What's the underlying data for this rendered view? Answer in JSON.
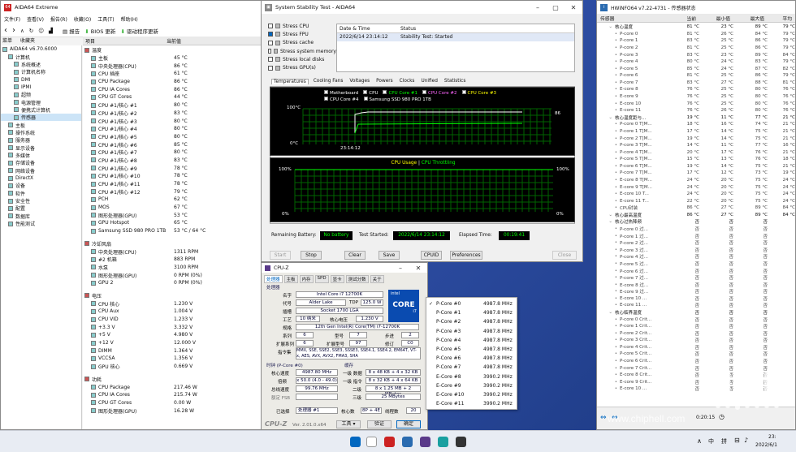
{
  "colors": {
    "aida_red": "#c8202a",
    "graph_green": "#00ff00",
    "graph_bg": "#000000",
    "graph_grid": "#006400",
    "accent": "#0067c0"
  },
  "aida": {
    "title": "AIDA64 Extreme",
    "menu": [
      "文件(F)",
      "查看(V)",
      "报告(R)",
      "收藏(O)",
      "工具(T)",
      "帮助(H)"
    ],
    "toolbar": {
      "report": "报告",
      "bios": "BIOS 更新",
      "driver": "驱动程序更新"
    },
    "tabs": [
      "菜单",
      "收藏夹"
    ],
    "tree": [
      {
        "label": "AIDA64 v6.70.6000",
        "indent": 0
      },
      {
        "label": "计算机",
        "indent": 1
      },
      {
        "label": "系统概述",
        "indent": 2
      },
      {
        "label": "计算机名称",
        "indent": 2
      },
      {
        "label": "DMI",
        "indent": 2
      },
      {
        "label": "IPMI",
        "indent": 2
      },
      {
        "label": "超频",
        "indent": 2
      },
      {
        "label": "电源管理",
        "indent": 2
      },
      {
        "label": "便携式计算机",
        "indent": 2
      },
      {
        "label": "传感器",
        "indent": 2
      },
      {
        "label": "主板",
        "indent": 1
      },
      {
        "label": "操作系统",
        "indent": 1
      },
      {
        "label": "服务器",
        "indent": 1
      },
      {
        "label": "显示设备",
        "indent": 1
      },
      {
        "label": "多媒体",
        "indent": 1
      },
      {
        "label": "存储设备",
        "indent": 1
      },
      {
        "label": "网络设备",
        "indent": 1
      },
      {
        "label": "DirectX",
        "indent": 1
      },
      {
        "label": "设备",
        "indent": 1
      },
      {
        "label": "软件",
        "indent": 1
      },
      {
        "label": "安全性",
        "indent": 1
      },
      {
        "label": "配置",
        "indent": 1
      },
      {
        "label": "数据库",
        "indent": 1
      },
      {
        "label": "性能测试",
        "indent": 1
      }
    ],
    "cols": {
      "item": "项目",
      "value": "当前值"
    },
    "sections": [
      {
        "title": "温度",
        "rows": [
          [
            "主板",
            "45 °C"
          ],
          [
            "中央处理器(CPU)",
            "86 °C"
          ],
          [
            "CPU 插座",
            "61 °C"
          ],
          [
            "CPU Package",
            "86 °C"
          ],
          [
            "CPU IA Cores",
            "86 °C"
          ],
          [
            "CPU GT Cores",
            "44 °C"
          ],
          [
            "CPU #1/核心 #1",
            "80 °C"
          ],
          [
            "CPU #1/核心 #2",
            "83 °C"
          ],
          [
            "CPU #1/核心 #3",
            "80 °C"
          ],
          [
            "CPU #1/核心 #4",
            "80 °C"
          ],
          [
            "CPU #1/核心 #5",
            "80 °C"
          ],
          [
            "CPU #1/核心 #6",
            "85 °C"
          ],
          [
            "CPU #1/核心 #7",
            "80 °C"
          ],
          [
            "CPU #1/核心 #8",
            "83 °C"
          ],
          [
            "CPU #1/核心 #9",
            "78 °C"
          ],
          [
            "CPU #1/核心 #10",
            "78 °C"
          ],
          [
            "CPU #1/核心 #11",
            "78 °C"
          ],
          [
            "CPU #1/核心 #12",
            "79 °C"
          ],
          [
            "PCH",
            "62 °C"
          ],
          [
            "MOS",
            "67 °C"
          ],
          [
            "图形处理器(GPU)",
            "53 °C"
          ],
          [
            "GPU Hotspot",
            "65 °C"
          ],
          [
            "Samsung SSD 980 PRO 1TB",
            "53 °C / 64 °C"
          ]
        ]
      },
      {
        "title": "冷却风扇",
        "rows": [
          [
            "中央处理器(CPU)",
            "1311 RPM"
          ],
          [
            "#2 机箱",
            "883 RPM"
          ],
          [
            "水泵",
            "3100 RPM"
          ],
          [
            "图形处理器(GPU)",
            "0 RPM  (0%)"
          ],
          [
            "GPU 2",
            "0 RPM  (0%)"
          ]
        ]
      },
      {
        "title": "电压",
        "rows": [
          [
            "CPU 核心",
            "1.230 V"
          ],
          [
            "CPU Aux",
            "1.004 V"
          ],
          [
            "CPU VID",
            "1.233 V"
          ],
          [
            "+3.3 V",
            "3.332 V"
          ],
          [
            "+5 V",
            "4.980 V"
          ],
          [
            "+12 V",
            "12.000 V"
          ],
          [
            "DIMM",
            "1.364 V"
          ],
          [
            "VCCSA",
            "1.356 V"
          ],
          [
            "GPU 核心",
            "0.669 V"
          ]
        ]
      },
      {
        "title": "功耗",
        "rows": [
          [
            "CPU Package",
            "217.46 W"
          ],
          [
            "CPU IA Cores",
            "215.74 W"
          ],
          [
            "CPU GT Cores",
            "0.00 W"
          ],
          [
            "图形处理器(GPU)",
            "16.28 W"
          ]
        ]
      }
    ]
  },
  "sst": {
    "title": "System Stability Test - AIDA64",
    "stress": [
      {
        "label": "Stress CPU",
        "checked": false
      },
      {
        "label": "Stress FPU",
        "checked": true
      },
      {
        "label": "Stress cache",
        "checked": false
      },
      {
        "label": "Stress system memory",
        "checked": false
      },
      {
        "label": "Stress local disks",
        "checked": false
      },
      {
        "label": "Stress GPU(s)",
        "checked": false
      }
    ],
    "log": {
      "col_dt": "Date & Time",
      "col_status": "Status",
      "dt": "2022/6/14 23:14:12",
      "status": "Stability Test: Started"
    },
    "tabs": [
      "Temperatures",
      "Cooling Fans",
      "Voltages",
      "Powers",
      "Clocks",
      "Unified",
      "Statistics"
    ],
    "legend": [
      "Motherboard",
      "CPU",
      "CPU Core #1",
      "CPU Core #2",
      "CPU Core #3",
      "CPU Core #4",
      "Samsung SSD 980 PRO 1TB"
    ],
    "graph1": {
      "ymax": "100°C",
      "ymin": "0°C",
      "time": "23:14:12",
      "val": "86"
    },
    "graph2": {
      "title_a": "CPU Usage",
      "sep": "|",
      "title_b": "CPU Throttling",
      "ymax": "100%",
      "ymin": "0%",
      "rmax": "100%",
      "rmin": "0%"
    },
    "battery_label": "Remaining Battery:",
    "battery_val": "No battery",
    "started_label": "Test Started:",
    "started_val": "2022/6/14 23:14:12",
    "elapsed_label": "Elapsed Time:",
    "elapsed_val": "00:19:41",
    "buttons": {
      "start": "Start",
      "stop": "Stop",
      "clear": "Clear",
      "save": "Save",
      "cpuid": "CPUID",
      "prefs": "Preferences",
      "close": "Close"
    }
  },
  "cpuz": {
    "title": "CPU-Z",
    "tabs": [
      "处理器",
      "主板",
      "内存",
      "SPD",
      "显卡",
      "测试分数",
      "关于"
    ],
    "group": "处理器",
    "name_l": "名字",
    "name": "Intel Core i7 12700K",
    "code_l": "代号",
    "code": "Alder Lake",
    "tdp_l": "TDP",
    "tdp": "125.0 W",
    "pkg_l": "插槽",
    "pkg": "Socket 1700 LGA",
    "tech_l": "工艺",
    "tech": "10 纳米",
    "vcore_l": "核心电压",
    "vcore": "1.230 V",
    "spec_l": "规格",
    "spec": "12th Gen Intel(R) Core(TM) i7-12700K",
    "fam_l": "系列",
    "fam": "6",
    "model_l": "型号",
    "model": "7",
    "step_l": "步进",
    "step": "2",
    "xfam_l": "扩展系列",
    "xfam": "6",
    "xmod_l": "扩展型号",
    "xmod": "97",
    "rev_l": "修订",
    "rev": "C0",
    "inst_l": "指令集",
    "inst": "MMX, SSE, SSE2, SSE3, SSSE3, SSE4.1, SSE4.2, EM64T, VT-x, AES, AVX, AVX2, FMA3, SHA",
    "clk_group": "时钟 (P-Core #0)",
    "cache_group": "缓存",
    "cs_l": "核心速度",
    "cs": "4987.80 MHz",
    "mul_l": "倍频",
    "mul": "x 50.0 (4.0 - 49.0)",
    "bus_l": "总线速度",
    "bus": "99.76 MHz",
    "fsb_l": "额定 FSB",
    "fsb": "",
    "l1d_l": "一级 数据",
    "l1d": "8 x 48 KB + 4 x 32 KB",
    "l1i_l": "一级 指令",
    "l1i": "8 x 32 KB + 4 x 64 KB",
    "l2_l": "二级",
    "l2": "8 x 1.25 MB + 2 MBytes",
    "l3_l": "三级",
    "l3": "25 MBytes",
    "sel_l": "已选择",
    "sel": "处理器 #1",
    "cores_l": "核心数",
    "cores": "8P + 4E",
    "thr_l": "线程数",
    "thr": "20",
    "brand": "CPU-Z",
    "ver": "Ver. 2.01.0.x64",
    "tools": "工具",
    "validate": "验证",
    "ok": "确定",
    "logo": {
      "l1": "intel",
      "l2": "CORE",
      "l3": "i7"
    }
  },
  "ctx": [
    {
      "name": "P-Core #0",
      "freq": "4987.8 MHz",
      "checked": true
    },
    {
      "name": "P-Core #1",
      "freq": "4987.8 MHz",
      "checked": false
    },
    {
      "name": "P-Core #2",
      "freq": "4987.8 MHz",
      "checked": false
    },
    {
      "name": "P-Core #3",
      "freq": "4987.8 MHz",
      "checked": false
    },
    {
      "name": "P-Core #4",
      "freq": "4987.8 MHz",
      "checked": false
    },
    {
      "name": "P-Core #5",
      "freq": "4987.8 MHz",
      "checked": false
    },
    {
      "name": "P-Core #6",
      "freq": "4987.8 MHz",
      "checked": false
    },
    {
      "name": "P-Core #7",
      "freq": "4987.8 MHz",
      "checked": false
    },
    {
      "name": "E-Core #8",
      "freq": "3990.2 MHz",
      "checked": false
    },
    {
      "name": "E-Core #9",
      "freq": "3990.2 MHz",
      "checked": false
    },
    {
      "name": "E-Core #10",
      "freq": "3990.2 MHz",
      "checked": false
    },
    {
      "name": "E-Core #11",
      "freq": "3990.2 MHz",
      "checked": false
    }
  ],
  "hw": {
    "title": "HWiNFO64 v7.22-4731 - 传感器状态",
    "cols": [
      "传感器",
      "当前",
      "最小值",
      "最大值",
      "平均"
    ],
    "rows": [
      [
        "核心温度",
        "81 °C",
        "23 °C",
        "89 °C",
        "79 °C"
      ],
      [
        "P-core 0",
        "81 °C",
        "26 °C",
        "84 °C",
        "79 °C"
      ],
      [
        "P-core 1",
        "83 °C",
        "25 °C",
        "86 °C",
        "79 °C"
      ],
      [
        "P-core 2",
        "81 °C",
        "25 °C",
        "86 °C",
        "79 °C"
      ],
      [
        "P-core 3",
        "83 °C",
        "23 °C",
        "89 °C",
        "84 °C"
      ],
      [
        "P-core 4",
        "80 °C",
        "24 °C",
        "83 °C",
        "79 °C"
      ],
      [
        "P-core 5",
        "85 °C",
        "24 °C",
        "87 °C",
        "82 °C"
      ],
      [
        "P-core 6",
        "81 °C",
        "25 °C",
        "86 °C",
        "79 °C"
      ],
      [
        "P-core 7",
        "83 °C",
        "27 °C",
        "88 °C",
        "81 °C"
      ],
      [
        "E-core 8",
        "76 °C",
        "25 °C",
        "80 °C",
        "76 °C"
      ],
      [
        "E-core 9",
        "76 °C",
        "25 °C",
        "80 °C",
        "76 °C"
      ],
      [
        "E-core 10",
        "76 °C",
        "25 °C",
        "80 °C",
        "76 °C"
      ],
      [
        "E-core 11",
        "76 °C",
        "26 °C",
        "80 °C",
        "76 °C"
      ],
      [
        "核心温度距与...",
        "19 °C",
        "11 °C",
        "77 °C",
        "21 °C"
      ],
      [
        "P-core 0 T[M...",
        "18 °C",
        "16 °C",
        "74 °C",
        "21 °C"
      ],
      [
        "P-core 1 T[M...",
        "17 °C",
        "14 °C",
        "75 °C",
        "21 °C"
      ],
      [
        "P-core 2 T[M...",
        "19 °C",
        "14 °C",
        "75 °C",
        "21 °C"
      ],
      [
        "P-core 3 T[M...",
        "14 °C",
        "11 °C",
        "77 °C",
        "16 °C"
      ],
      [
        "P-core 4 T[M...",
        "20 °C",
        "17 °C",
        "76 °C",
        "21 °C"
      ],
      [
        "P-core 5 T[M...",
        "15 °C",
        "13 °C",
        "76 °C",
        "18 °C"
      ],
      [
        "P-core 6 T[M...",
        "19 °C",
        "14 °C",
        "75 °C",
        "21 °C"
      ],
      [
        "P-core 7 T[M...",
        "17 °C",
        "12 °C",
        "73 °C",
        "19 °C"
      ],
      [
        "E-core 8 T[M...",
        "24 °C",
        "20 °C",
        "75 °C",
        "24 °C"
      ],
      [
        "E-core 9 T[M...",
        "24 °C",
        "20 °C",
        "75 °C",
        "24 °C"
      ],
      [
        "E-core 10 T...",
        "24 °C",
        "20 °C",
        "75 °C",
        "24 °C"
      ],
      [
        "E-core 11 T...",
        "22 °C",
        "20 °C",
        "75 °C",
        "24 °C"
      ],
      [
        "CPU封装",
        "86 °C",
        "27 °C",
        "89 °C",
        "84 °C"
      ],
      [
        "核心最高温度",
        "86 °C",
        "27 °C",
        "89 °C",
        "84 °C"
      ],
      [
        "核心过热降频",
        "否",
        "否",
        "否",
        ""
      ],
      [
        "P-core 0 过...",
        "否",
        "否",
        "否",
        ""
      ],
      [
        "P-core 1 过...",
        "否",
        "否",
        "否",
        ""
      ],
      [
        "P-core 2 过...",
        "否",
        "否",
        "否",
        ""
      ],
      [
        "P-core 3 过...",
        "否",
        "否",
        "否",
        ""
      ],
      [
        "P-core 4 过...",
        "否",
        "否",
        "否",
        ""
      ],
      [
        "P-core 5 过...",
        "否",
        "否",
        "否",
        ""
      ],
      [
        "P-core 6 过...",
        "否",
        "否",
        "否",
        ""
      ],
      [
        "P-core 7 过...",
        "否",
        "否",
        "否",
        ""
      ],
      [
        "E-core 8 过...",
        "否",
        "否",
        "否",
        ""
      ],
      [
        "E-core 9 过...",
        "否",
        "否",
        "否",
        ""
      ],
      [
        "E-core 10 ...",
        "否",
        "否",
        "否",
        ""
      ],
      [
        "E-core 11 ...",
        "否",
        "否",
        "否",
        ""
      ],
      [
        "核心临界温度",
        "否",
        "否",
        "否",
        ""
      ],
      [
        "P-core 0 Crit...",
        "否",
        "否",
        "否",
        ""
      ],
      [
        "P-core 1 Crit...",
        "否",
        "否",
        "否",
        ""
      ],
      [
        "P-core 2 Crit...",
        "否",
        "否",
        "否",
        ""
      ],
      [
        "P-core 3 Crit...",
        "否",
        "否",
        "否",
        ""
      ],
      [
        "P-core 4 Crit...",
        "否",
        "否",
        "否",
        ""
      ],
      [
        "P-core 5 Crit...",
        "否",
        "否",
        "否",
        ""
      ],
      [
        "P-core 6 Crit...",
        "否",
        "否",
        "否",
        ""
      ],
      [
        "P-core 7 Crit...",
        "否",
        "否",
        "否",
        ""
      ],
      [
        "E-core 8 Crit...",
        "否",
        "否",
        "否",
        ""
      ],
      [
        "E-core 9 Crit...",
        "否",
        "否",
        "否",
        ""
      ],
      [
        "E-core 10 ...",
        "否",
        "否",
        "否",
        ""
      ]
    ],
    "elapsed": "0:20:15"
  },
  "watermark": "www.chiphell.com",
  "taskbar": {
    "ime1": "中",
    "ime2": "拼",
    "time": "23:",
    "date": "2022/6/1"
  }
}
